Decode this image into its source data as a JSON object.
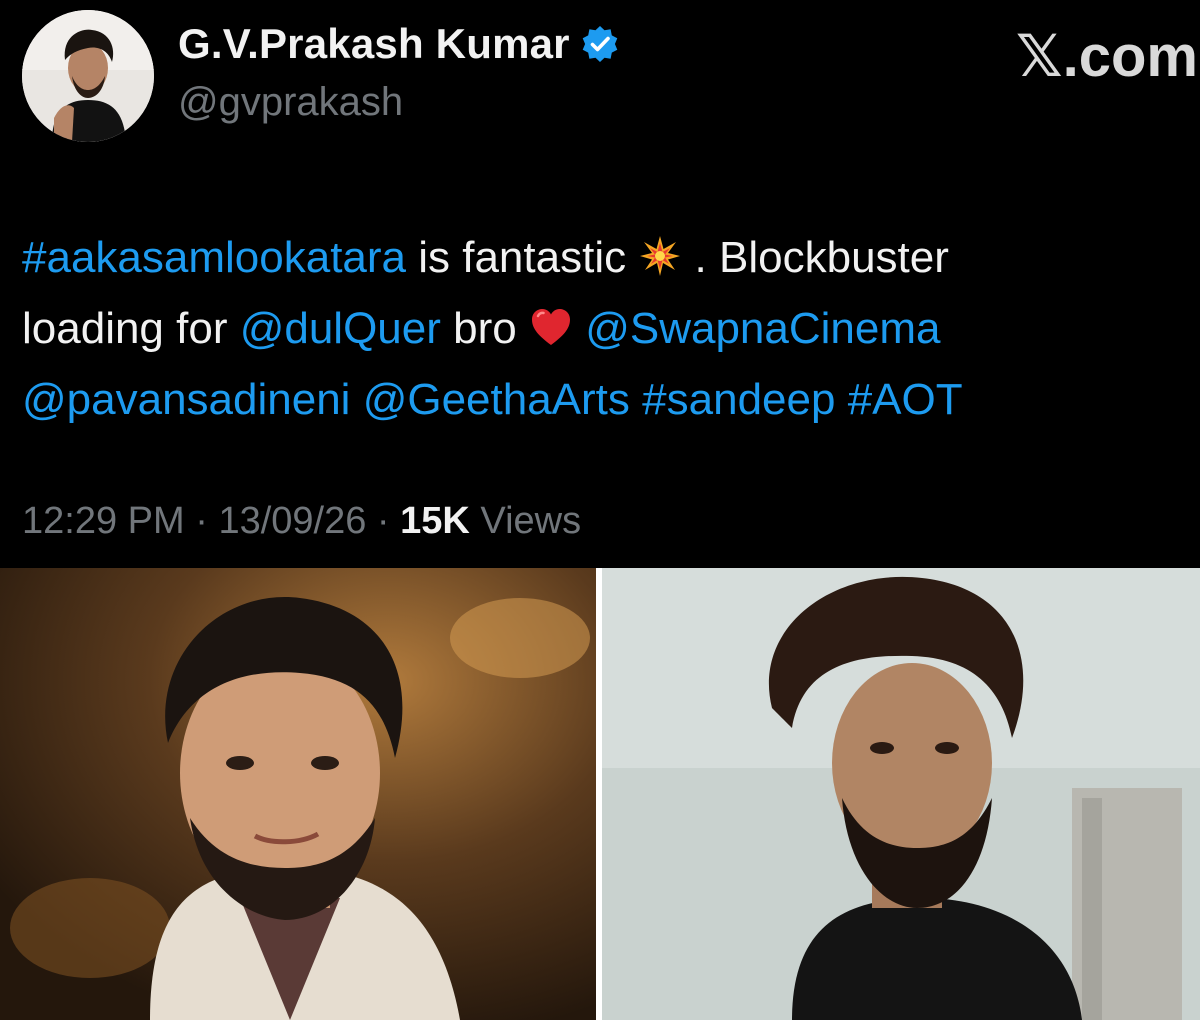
{
  "author": {
    "display_name": "G.V.Prakash Kumar",
    "handle": "@gvprakash",
    "verified_icon": "verified-badge-icon"
  },
  "brand": {
    "label": "𝕏.com"
  },
  "tweet": {
    "line1": [
      {
        "text": "#aakasamlookatara",
        "link": true
      },
      {
        "text": " is fantastic ",
        "link": false
      },
      {
        "emoji": "collision-emoji-icon"
      },
      {
        "text": " . Blockbuster",
        "link": false
      }
    ],
    "hashtag_1": "#aakasamlookatara",
    "text_1": " is fantastic ",
    "text_2": " . Blockbuster",
    "text_3": "loading for ",
    "mention_1": "@dulQuer",
    "text_4": " bro ",
    "mention_2": "@SwapnaCinema",
    "mention_3": "@pavansadineni",
    "mention_4": "@GeethaArts",
    "hashtag_2": "#sandeep",
    "hashtag_3": "#AOT"
  },
  "meta": {
    "time": "12:29 PM",
    "sep1": " · ",
    "date": "13/09/26",
    "sep2": " · ",
    "views_count": "15K",
    "views_label": " Views"
  },
  "colors": {
    "link": "#1d9bf0",
    "muted": "#71767b",
    "background": "#000000"
  }
}
